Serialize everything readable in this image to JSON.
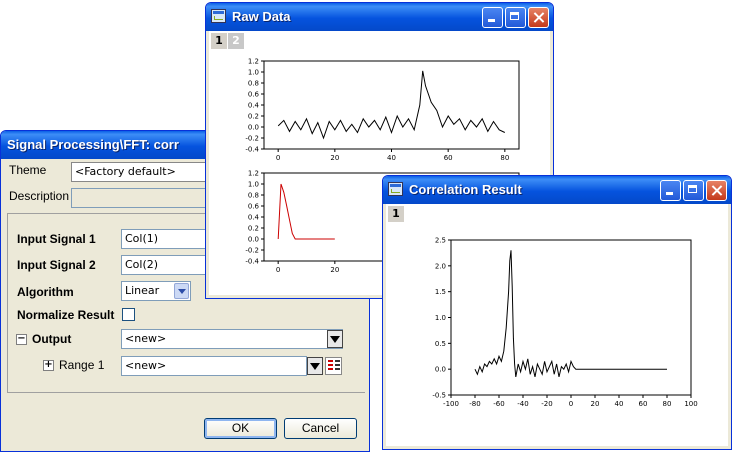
{
  "dialog": {
    "title": "Signal Processing\\FFT: corr",
    "theme_label": "Theme",
    "theme_value": "<Factory default>",
    "description_label": "Description",
    "description_value": "",
    "input_signal_1_label": "Input Signal 1",
    "input_signal_1_value": "Col(1)",
    "input_signal_2_label": "Input Signal 2",
    "input_signal_2_value": "Col(2)",
    "algorithm_label": "Algorithm",
    "algorithm_value": "Linear",
    "normalize_label": "Normalize Result",
    "normalize_checked": false,
    "output_label": "Output",
    "output_value": "<new>",
    "range_label": "Range 1",
    "range_value": "<new>",
    "ok_label": "OK",
    "cancel_label": "Cancel"
  },
  "raw_data": {
    "title": "Raw Data",
    "tabs": [
      "1",
      "2"
    ],
    "active_tab": "1"
  },
  "correlation": {
    "title": "Correlation Result",
    "tabs": [
      "1"
    ],
    "active_tab": "1"
  },
  "icons": [
    "window-app-icon",
    "minimize-icon",
    "maximize-icon",
    "close-icon",
    "dropdown-arrow-icon",
    "collapse-icon",
    "expand-icon",
    "range-picker-icon"
  ],
  "colors": {
    "title_bar": "#0553de",
    "frame": "#ece9d8",
    "close_button": "#c4391b",
    "signal2_line": "#cc0000"
  },
  "chart_data": [
    {
      "type": "line",
      "name_ref": "raw-signal-1",
      "x": [
        0,
        2,
        4,
        6,
        8,
        10,
        12,
        14,
        16,
        18,
        20,
        22,
        24,
        26,
        28,
        30,
        32,
        34,
        36,
        38,
        40,
        42,
        44,
        46,
        48,
        50,
        51,
        52,
        54,
        56,
        58,
        60,
        62,
        64,
        66,
        68,
        70,
        72,
        74,
        76,
        78,
        80
      ],
      "y": [
        0.02,
        0.12,
        -0.08,
        0.1,
        -0.05,
        0.15,
        -0.12,
        0.08,
        -0.2,
        0.1,
        -0.05,
        0.12,
        -0.08,
        0.05,
        -0.1,
        0.15,
        0.0,
        0.12,
        -0.05,
        0.18,
        -0.1,
        0.2,
        0.0,
        0.15,
        -0.05,
        0.4,
        1.02,
        0.75,
        0.45,
        0.3,
        0.0,
        0.2,
        0.05,
        0.15,
        -0.05,
        0.12,
        0.0,
        0.15,
        -0.08,
        0.1,
        -0.05,
        -0.1
      ],
      "xlim": [
        -5,
        85
      ],
      "ylim": [
        -0.4,
        1.2
      ],
      "xticks": [
        0,
        20,
        40,
        60,
        80
      ],
      "yticks": [
        -0.4,
        -0.2,
        0.0,
        0.2,
        0.4,
        0.6,
        0.8,
        1.0,
        1.2
      ],
      "ytick_labels": [
        "-0.4",
        "-0.2",
        "0.0",
        "0.2",
        "0.4",
        "0.6",
        "0.8",
        "1.0",
        "1.2"
      ],
      "color": "#000000"
    },
    {
      "type": "line",
      "name_ref": "raw-signal-2",
      "x": [
        0,
        1,
        2,
        3,
        4,
        5,
        6,
        8,
        10,
        12,
        14,
        16,
        18,
        20
      ],
      "y": [
        0.0,
        1.0,
        0.85,
        0.6,
        0.35,
        0.1,
        0.0,
        0.0,
        0.0,
        0.0,
        0.0,
        0.0,
        0.0,
        0.0
      ],
      "xlim": [
        -5,
        85
      ],
      "ylim": [
        -0.4,
        1.2
      ],
      "xticks": [
        0,
        20
      ],
      "yticks": [
        -0.4,
        -0.2,
        0.0,
        0.2,
        0.4,
        0.6,
        0.8,
        1.0,
        1.2
      ],
      "ytick_labels": [
        "-0.4",
        "-0.2",
        "0.0",
        "0.2",
        "0.4",
        "0.6",
        "0.8",
        "1.0",
        "1.2"
      ],
      "color": "#cc0000"
    },
    {
      "type": "line",
      "name_ref": "correlation-result",
      "x": [
        -80,
        -78,
        -76,
        -74,
        -72,
        -70,
        -68,
        -66,
        -64,
        -62,
        -60,
        -58,
        -56,
        -54,
        -52,
        -51,
        -50,
        -49,
        -48,
        -47,
        -46,
        -44,
        -42,
        -40,
        -38,
        -36,
        -34,
        -32,
        -30,
        -28,
        -26,
        -24,
        -22,
        -20,
        -18,
        -16,
        -14,
        -12,
        -10,
        -8,
        -6,
        -4,
        -2,
        0,
        2,
        4,
        6,
        10,
        20,
        30,
        40,
        50,
        60,
        70,
        80
      ],
      "y": [
        0.0,
        -0.1,
        0.05,
        -0.05,
        0.1,
        0.05,
        0.15,
        0.1,
        0.2,
        0.1,
        0.25,
        0.15,
        0.35,
        0.8,
        1.5,
        2.1,
        2.3,
        1.6,
        0.6,
        0.1,
        -0.15,
        0.1,
        -0.05,
        0.15,
        0.0,
        0.2,
        -0.1,
        0.05,
        -0.15,
        0.1,
        0.0,
        -0.1,
        0.15,
        -0.05,
        0.05,
        0.15,
        -0.1,
        0.1,
        -0.15,
        0.05,
        0.0,
        0.1,
        -0.05,
        0.15,
        0.05,
        0.0,
        0.0,
        0.0,
        0.0,
        0.0,
        0.0,
        0.0,
        0.0,
        0.0,
        0.0
      ],
      "xlim": [
        -100,
        100
      ],
      "ylim": [
        -0.5,
        2.5
      ],
      "xticks": [
        -100,
        -80,
        -60,
        -40,
        -20,
        0,
        20,
        40,
        60,
        80,
        100
      ],
      "yticks": [
        -0.5,
        0.0,
        0.5,
        1.0,
        1.5,
        2.0,
        2.5
      ],
      "ytick_labels": [
        "-0.5",
        "0.0",
        "0.5",
        "1.0",
        "1.5",
        "2.0",
        "2.5"
      ],
      "color": "#000000"
    }
  ]
}
